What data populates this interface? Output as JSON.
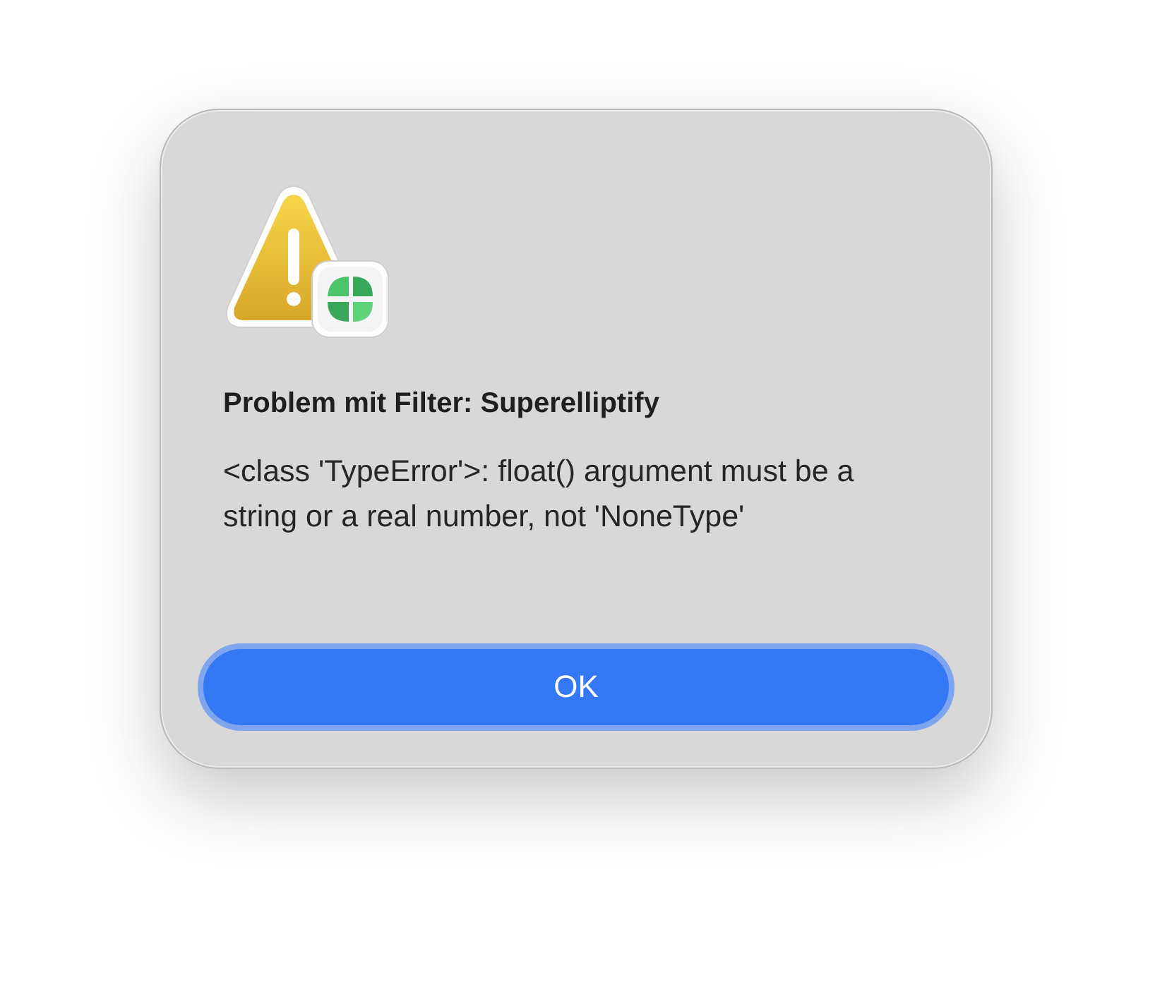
{
  "dialog": {
    "title": "Problem mit Filter: Superelliptify",
    "message": "<class 'TypeError'>: float() argument must be a string or a real number, not 'NoneType'",
    "buttons": [
      {
        "label": "OK",
        "default": true
      }
    ]
  }
}
